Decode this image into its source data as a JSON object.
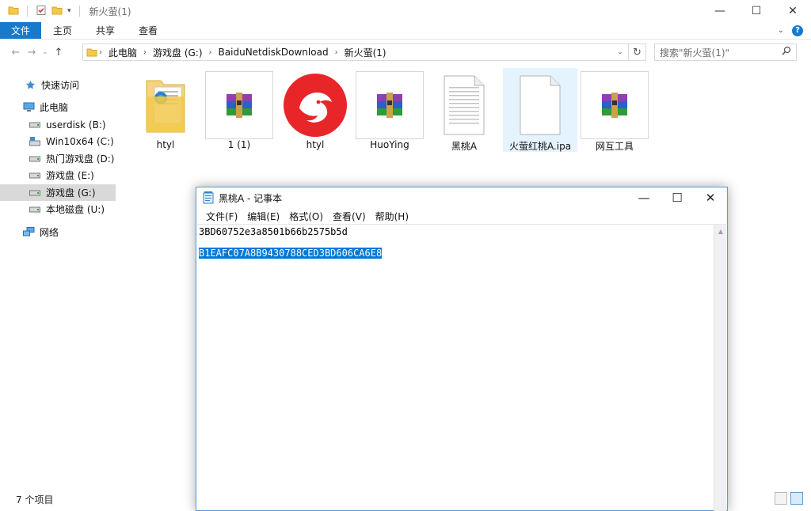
{
  "explorer": {
    "title": "新火萤(1)",
    "window_controls": {
      "minimize": "—",
      "maximize": "☐",
      "close": "✕"
    },
    "ribbon_tabs": [
      "文件",
      "主页",
      "共享",
      "查看"
    ],
    "help": "?",
    "address": {
      "crumbs": [
        "此电脑",
        "游戏盘 (G:)",
        "BaiduNetdiskDownload",
        "新火萤(1)"
      ]
    },
    "search_placeholder": "搜索\"新火萤(1)\"",
    "sidebar": {
      "quick_access": "快速访问",
      "this_pc": "此电脑",
      "drives": [
        "userdisk (B:)",
        "Win10x64 (C:)",
        "热门游戏盘 (D:)",
        "游戏盘 (E:)",
        "游戏盘 (G:)",
        "本地磁盘 (U:)"
      ],
      "network": "网络"
    },
    "files": [
      {
        "name": "htyl",
        "icon": "folder-icon"
      },
      {
        "name": "1 (1)",
        "icon": "winrar-archive-icon"
      },
      {
        "name": "htyl",
        "icon": "app-logo-icon"
      },
      {
        "name": "HuoYing",
        "icon": "winrar-archive-icon"
      },
      {
        "name": "黑桃A",
        "icon": "text-document-icon"
      },
      {
        "name": "火萤红桃A.ipa",
        "icon": "blank-file-icon"
      },
      {
        "name": "网互工具",
        "icon": "winrar-archive-icon"
      }
    ],
    "status": "7 个项目"
  },
  "notepad": {
    "title": "黑桃A - 记事本",
    "window_controls": {
      "minimize": "—",
      "maximize": "☐",
      "close": "✕"
    },
    "menu": [
      "文件(F)",
      "编辑(E)",
      "格式(O)",
      "查看(V)",
      "帮助(H)"
    ],
    "lines": [
      "3BD60752e3a8501b66b2575b5d",
      "",
      "B1EAFC07A8B9430788CED3BD606CA6E8"
    ],
    "selected_line": "B1EAFC07A8B9430788CED3BD606CA6E8"
  },
  "colors": {
    "accent": "#1979ca",
    "selection": "#0078d7",
    "selected_item": "#e5f3ff"
  }
}
